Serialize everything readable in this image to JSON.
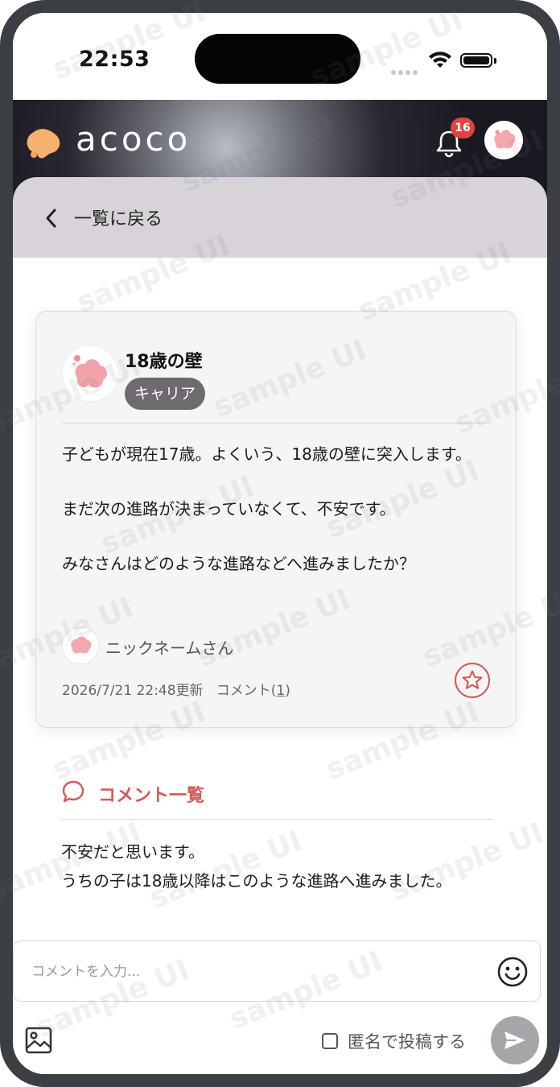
{
  "status_bar": {
    "time": "22:53"
  },
  "header": {
    "logo_text": "acoco",
    "notification_count": "16"
  },
  "nav": {
    "back_label": "一覧に戻る"
  },
  "post": {
    "title": "18歳の壁",
    "category": "キャリア",
    "body_paragraphs": [
      "子どもが現在17歳。よくいう、18歳の壁に突入します。",
      "まだ次の進路が決まっていなくて、不安です。",
      "みなさんはどのような進路などへ進みましたか？"
    ],
    "author": "ニックネームさん",
    "updated": "2026/7/21 22:48更新",
    "comment_label": "コメント(",
    "comment_count": "1",
    "comment_close": ")"
  },
  "comments": {
    "heading": "コメント一覧",
    "items": [
      {
        "lines": [
          "不安だと思います。",
          "うちの子は18歳以降はこのような進路へ進みました。"
        ]
      }
    ]
  },
  "composer": {
    "placeholder": "コメントを入力...",
    "anonymous_label": "匿名で投稿する",
    "anonymous_checked": false
  },
  "watermark": "sample UI",
  "colors": {
    "accent": "#d45a54",
    "badge": "#e0443e",
    "header_dark": "#1a1820",
    "tag_bg": "#6e6a70"
  },
  "icons": [
    "bell-icon",
    "chevron-left-icon",
    "star-icon",
    "speech-bubble-icon",
    "smiley-icon",
    "image-icon",
    "send-icon"
  ]
}
